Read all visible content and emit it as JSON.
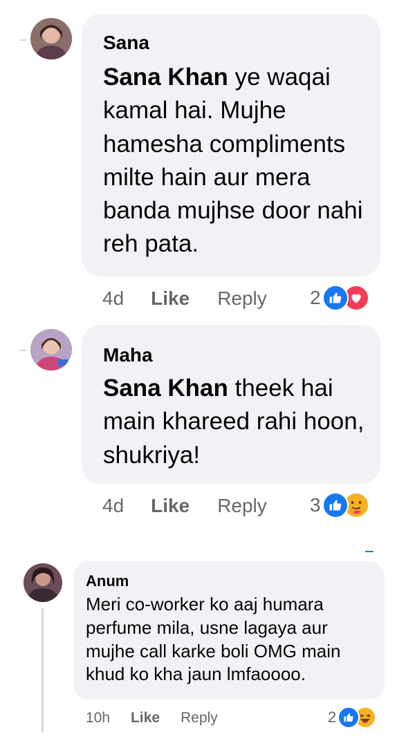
{
  "comments": [
    {
      "author": "Sana",
      "mention": "Sana Khan",
      "text_line1": " ye waqai",
      "text_rest": "kamal hai. Mujhe hamesha compliments milte hain aur mera banda mujhse door nahi reh pata.",
      "time": "4d",
      "like_label": "Like",
      "reply_label": "Reply",
      "reaction_count": "2",
      "reactions": [
        "like-icon",
        "love-icon"
      ]
    },
    {
      "author": "Maha",
      "mention": "Sana Khan",
      "text_line1": " theek hai",
      "text_rest": "main khareed rahi hoon, shukriya!",
      "time": "4d",
      "like_label": "Like",
      "reply_label": "Reply",
      "reaction_count": "3",
      "reactions": [
        "like-icon",
        "care-icon"
      ]
    },
    {
      "author": "Anum",
      "text": "Meri co-worker ko aaj humara perfume mila, usne lagaya aur mujhe call karke boli OMG main khud ko kha jaun lmfaoooo.",
      "time": "10h",
      "like_label": "Like",
      "reply_label": "Reply",
      "reaction_count": "2",
      "reactions": [
        "like-icon",
        "haha-icon"
      ]
    }
  ],
  "colors": {
    "bubble": "#f0f2f5",
    "meta_text": "#65676b",
    "like_blue": "#1877f2",
    "love_red": "#f33e58",
    "emoji_yellow": "#f7b125"
  }
}
